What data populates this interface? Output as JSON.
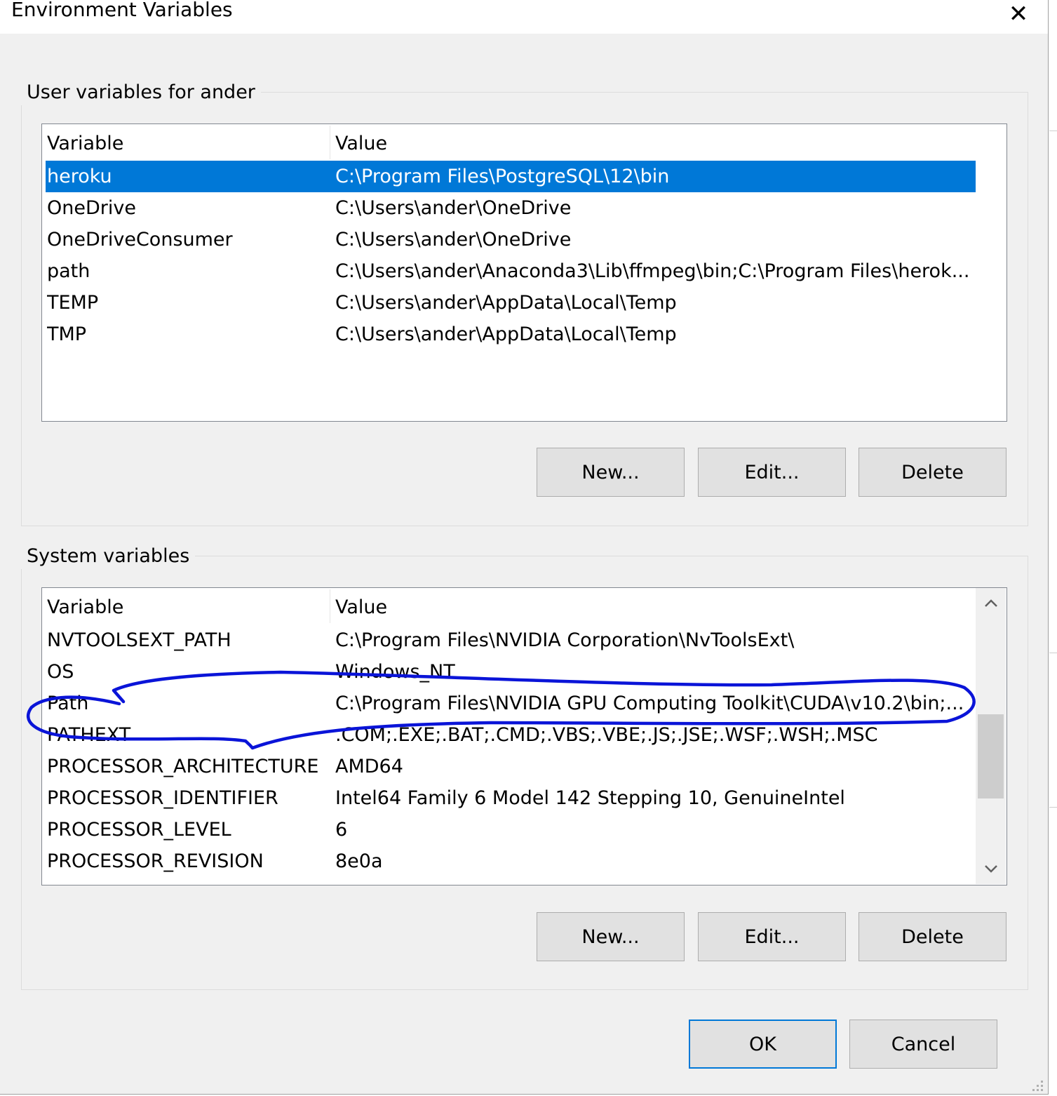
{
  "window": {
    "title": "Environment Variables",
    "close_glyph": "✕"
  },
  "user_vars": {
    "group_label": "User variables for ander",
    "headers": {
      "variable": "Variable",
      "value": "Value"
    },
    "rows": [
      {
        "variable": "heroku",
        "value": "C:\\Program Files\\PostgreSQL\\12\\bin",
        "selected": true
      },
      {
        "variable": "OneDrive",
        "value": "C:\\Users\\ander\\OneDrive"
      },
      {
        "variable": "OneDriveConsumer",
        "value": "C:\\Users\\ander\\OneDrive"
      },
      {
        "variable": "path",
        "value": "C:\\Users\\ander\\Anaconda3\\Lib\\ffmpeg\\bin;C:\\Program Files\\herok..."
      },
      {
        "variable": "TEMP",
        "value": "C:\\Users\\ander\\AppData\\Local\\Temp"
      },
      {
        "variable": "TMP",
        "value": "C:\\Users\\ander\\AppData\\Local\\Temp"
      }
    ],
    "buttons": {
      "new": "New...",
      "edit": "Edit...",
      "delete": "Delete"
    }
  },
  "system_vars": {
    "group_label": "System variables",
    "headers": {
      "variable": "Variable",
      "value": "Value"
    },
    "rows": [
      {
        "variable": "NVTOOLSEXT_PATH",
        "value": "C:\\Program Files\\NVIDIA Corporation\\NvToolsExt\\"
      },
      {
        "variable": "OS",
        "value": "Windows_NT"
      },
      {
        "variable": "Path",
        "value": "C:\\Program Files\\NVIDIA GPU Computing Toolkit\\CUDA\\v10.2\\bin;..."
      },
      {
        "variable": "PATHEXT",
        "value": ".COM;.EXE;.BAT;.CMD;.VBS;.VBE;.JS;.JSE;.WSF;.WSH;.MSC"
      },
      {
        "variable": "PROCESSOR_ARCHITECTURE",
        "value": "AMD64"
      },
      {
        "variable": "PROCESSOR_IDENTIFIER",
        "value": "Intel64 Family 6 Model 142 Stepping 10, GenuineIntel"
      },
      {
        "variable": "PROCESSOR_LEVEL",
        "value": "6"
      },
      {
        "variable": "PROCESSOR_REVISION",
        "value": "8e0a"
      }
    ],
    "buttons": {
      "new": "New...",
      "edit": "Edit...",
      "delete": "Delete"
    },
    "scrollbar": {
      "up_icon": "chevron-up-icon",
      "down_icon": "chevron-down-icon"
    }
  },
  "footer": {
    "ok": "OK",
    "cancel": "Cancel"
  },
  "colors": {
    "selection": "#0078d7",
    "annotation_ink": "#0a14d8",
    "dialog_bg": "#f0f0f0"
  }
}
